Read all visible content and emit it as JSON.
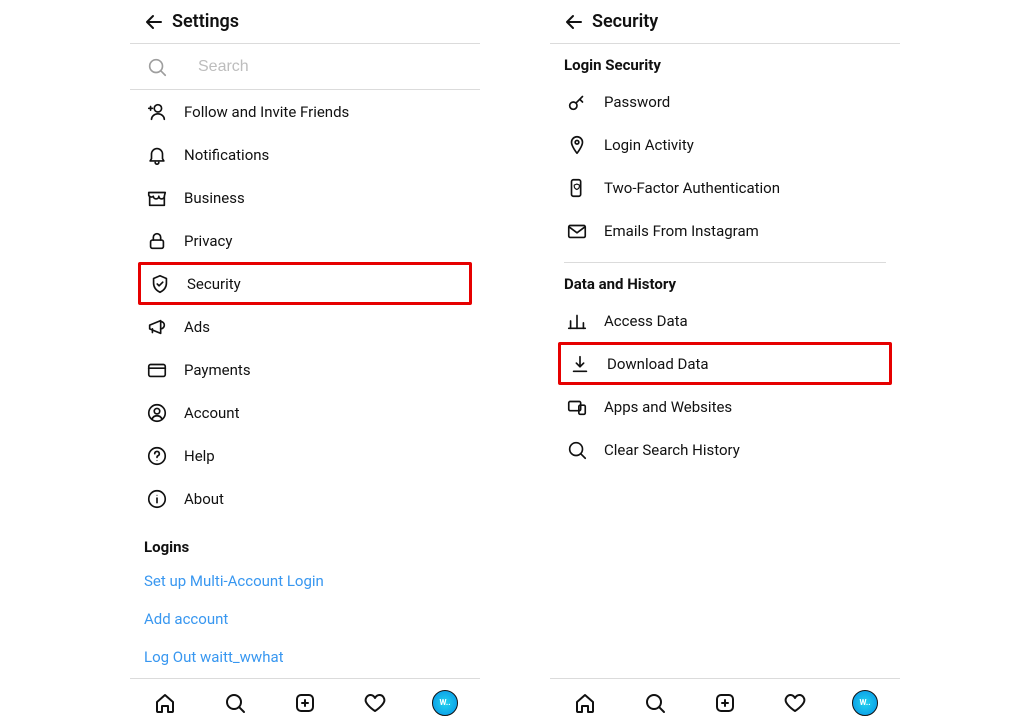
{
  "left": {
    "title": "Settings",
    "search_placeholder": "Search",
    "items": [
      {
        "key": "invite",
        "icon": "invite-icon",
        "label": "Follow and Invite Friends"
      },
      {
        "key": "notifications",
        "icon": "bell-icon",
        "label": "Notifications"
      },
      {
        "key": "business",
        "icon": "storefront-icon",
        "label": "Business"
      },
      {
        "key": "privacy",
        "icon": "lock-icon",
        "label": "Privacy"
      },
      {
        "key": "security",
        "icon": "shield-check-icon",
        "label": "Security",
        "highlight": true
      },
      {
        "key": "ads",
        "icon": "megaphone-icon",
        "label": "Ads"
      },
      {
        "key": "payments",
        "icon": "card-icon",
        "label": "Payments"
      },
      {
        "key": "account",
        "icon": "person-circle-icon",
        "label": "Account"
      },
      {
        "key": "help",
        "icon": "help-circle-icon",
        "label": "Help"
      },
      {
        "key": "about",
        "icon": "info-circle-icon",
        "label": "About"
      }
    ],
    "logins_header": "Logins",
    "login_links": [
      {
        "key": "multi",
        "label": "Set up Multi-Account Login"
      },
      {
        "key": "add",
        "label": "Add account"
      },
      {
        "key": "logout",
        "label": "Log Out waitt_wwhat"
      }
    ]
  },
  "right": {
    "title": "Security",
    "sections": [
      {
        "header": "Login Security",
        "items": [
          {
            "key": "password",
            "icon": "key-icon",
            "label": "Password"
          },
          {
            "key": "activity",
            "icon": "pin-icon",
            "label": "Login Activity"
          },
          {
            "key": "twofactor",
            "icon": "phone-shield-icon",
            "label": "Two-Factor Authentication"
          },
          {
            "key": "emails",
            "icon": "mail-icon",
            "label": "Emails From Instagram"
          }
        ]
      },
      {
        "header": "Data and History",
        "items": [
          {
            "key": "access",
            "icon": "bars-icon",
            "label": "Access Data"
          },
          {
            "key": "download",
            "icon": "download-icon",
            "label": "Download Data",
            "highlight": true
          },
          {
            "key": "apps",
            "icon": "devices-icon",
            "label": "Apps and Websites"
          },
          {
            "key": "clear",
            "icon": "search-icon",
            "label": "Clear Search History"
          }
        ]
      }
    ]
  },
  "nav": {
    "items": [
      {
        "key": "home",
        "icon": "home-icon"
      },
      {
        "key": "search",
        "icon": "search-icon"
      },
      {
        "key": "create",
        "icon": "plus-square-icon"
      },
      {
        "key": "activity",
        "icon": "heart-icon"
      },
      {
        "key": "profile",
        "icon": "avatar-icon",
        "avatar_text": "W.."
      }
    ]
  }
}
